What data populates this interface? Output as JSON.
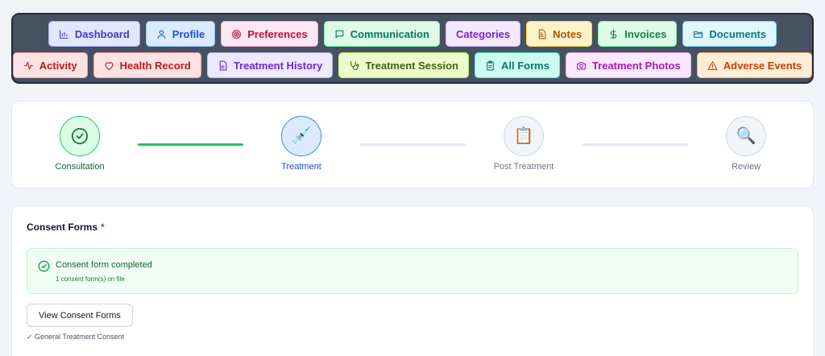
{
  "nav": {
    "row1": [
      {
        "label": "Dashboard",
        "icon": "bar-chart-icon",
        "bg": "#e0e7ff",
        "border": "#a5b4fc",
        "color": "#4338ca"
      },
      {
        "label": "Profile",
        "icon": "user-icon",
        "bg": "#dbeafe",
        "border": "#93c5fd",
        "color": "#1d4ed8"
      },
      {
        "label": "Preferences",
        "icon": "target-icon",
        "bg": "#fce7f3",
        "border": "#f9a8d4",
        "color": "#be123c"
      },
      {
        "label": "Communication",
        "icon": "chat-icon",
        "bg": "#dcfce7",
        "border": "#86efac",
        "color": "#047857"
      },
      {
        "label": "Categories",
        "icon": "",
        "bg": "#f3e8ff",
        "border": "#d8b4fe",
        "color": "#7e22ce"
      },
      {
        "label": "Notes",
        "icon": "note-icon",
        "bg": "#fef3c7",
        "border": "#fcd34d",
        "color": "#b45309"
      },
      {
        "label": "Invoices",
        "icon": "dollar-icon",
        "bg": "#dcfce7",
        "border": "#86efac",
        "color": "#15803d"
      },
      {
        "label": "Documents",
        "icon": "folder-icon",
        "bg": "#e0f7fe",
        "border": "#7dd3fc",
        "color": "#0e7490"
      }
    ],
    "row2": [
      {
        "label": "Activity",
        "icon": "activity-icon",
        "bg": "#fee2e2",
        "border": "#fca5a5",
        "color": "#b91c1c"
      },
      {
        "label": "Health Record",
        "icon": "heart-icon",
        "bg": "#fee2e2",
        "border": "#fca5a5",
        "color": "#b91c1c"
      },
      {
        "label": "Treatment History",
        "icon": "file-text-icon",
        "bg": "#ede9fe",
        "border": "#c4b5fd",
        "color": "#6d28d9"
      },
      {
        "label": "Treatment Session",
        "icon": "stethoscope-icon",
        "bg": "#ecfccb",
        "border": "#bef264",
        "color": "#3f6212"
      },
      {
        "label": "All Forms",
        "icon": "clipboard-icon",
        "bg": "#ccfbf1",
        "border": "#5eead4",
        "color": "#0f766e"
      },
      {
        "label": "Treatment Photos",
        "icon": "camera-icon",
        "bg": "#fae8ff",
        "border": "#f0abfc",
        "color": "#a21caf"
      },
      {
        "label": "Adverse Events",
        "icon": "warning-icon",
        "bg": "#ffedd5",
        "border": "#fdba74",
        "color": "#c2410c"
      }
    ]
  },
  "steps": [
    {
      "label": "Consultation",
      "icon": "check-circle-icon",
      "state": "complete",
      "glyph": ""
    },
    {
      "label": "Treatment",
      "icon": "syringe-icon",
      "state": "active",
      "glyph": "💉"
    },
    {
      "label": "Post Treatment",
      "icon": "clipboard-icon",
      "state": "pending",
      "glyph": "📋"
    },
    {
      "label": "Review",
      "icon": "magnifier-icon",
      "state": "pending",
      "glyph": "🔍"
    }
  ],
  "consent": {
    "title": "Consent Forms",
    "required_mark": "*",
    "status_title": "Consent form completed",
    "status_sub": "1 consent form(s) on file",
    "button_label": "View Consent Forms",
    "forms": [
      "✓ General Treatment Consent"
    ]
  },
  "colors": {
    "complete": "#22c55e",
    "active": "#3b82f6",
    "pending_line": "#e2e8f0"
  }
}
